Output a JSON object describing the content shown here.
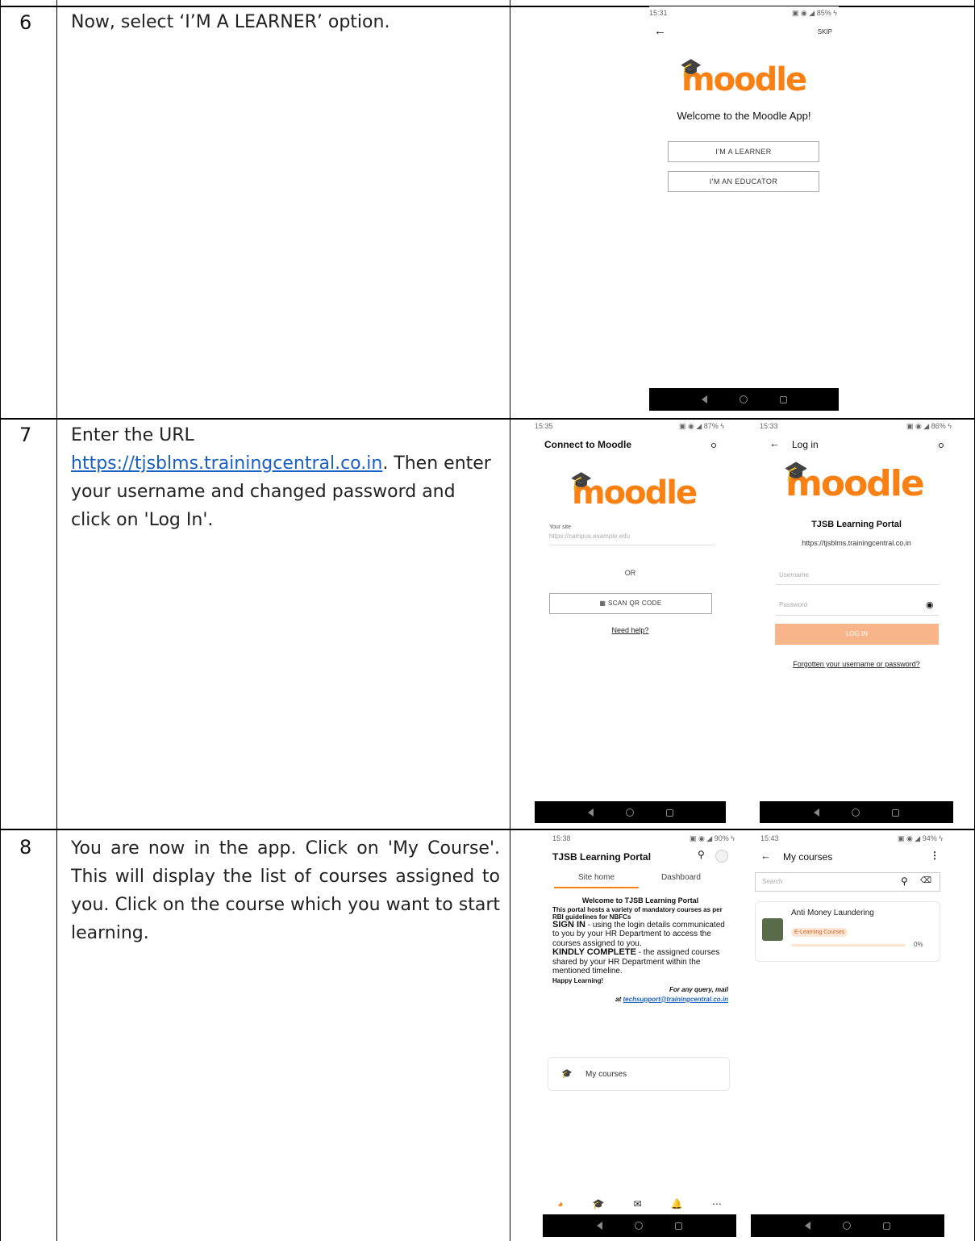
{
  "rows": [
    {
      "num": "6",
      "text": "Now, select ‘I’M A LEARNER’ option."
    },
    {
      "num": "7",
      "text_before": "Enter the URL ",
      "link": "https://tjsblms.trainingcentral.co.in",
      "text_after": ". Then enter your username and changed password and click on 'Log In'."
    },
    {
      "num": "8",
      "text": "You are now in the app. Click on 'My Course'. This will display the list of courses assigned to you. Click on the course which you want to start learning."
    }
  ],
  "screen_welcome": {
    "time": "15:31",
    "battery": "85%",
    "skip": "SKIP",
    "logo": "moodle",
    "title": "Welcome to the Moodle App!",
    "learner_button": "I'M A LEARNER",
    "educator_button": "I'M AN EDUCATOR"
  },
  "screen_connect": {
    "time": "15:35",
    "battery": "87%",
    "title": "Connect to Moodle",
    "logo": "moodle",
    "site_label": "Your site",
    "site_placeholder": "https://campus.example.edu",
    "or": "OR",
    "scan_button": "SCAN QR CODE",
    "help_link": "Need help?"
  },
  "screen_login": {
    "time": "15:33",
    "battery": "86%",
    "title": "Log in",
    "logo": "moodle",
    "portal": "TJSB Learning Portal",
    "url": "https://tjsblms.trainingcentral.co.in",
    "username_placeholder": "Username",
    "password_placeholder": "Password",
    "login_button": "LOG IN",
    "forgot_link": "Forgotten your username or password?"
  },
  "screen_home": {
    "time": "15:38",
    "battery": "90%",
    "title": "TJSB Learning Portal",
    "tabs": [
      "Site home",
      "Dashboard"
    ],
    "welcome_heading": "Welcome to TJSB Learning Portal",
    "intro": "This portal hosts a variety of mandatory courses as per RBI guidelines for NBFCs",
    "sign_in_label": "SIGN IN",
    "sign_in_text": " - using the login details communicated to you by your HR Department to access the courses assigned to you.",
    "complete_label": "KINDLY COMPLETE",
    "complete_text": " - the assigned courses shared by your HR Department within the mentioned timeline.",
    "happy": "Happy Learning!",
    "query": "For any query, mail",
    "at": "at ",
    "email": "techsupport@trainingcentral.co.in",
    "my_courses": "My courses"
  },
  "screen_courses": {
    "time": "15:43",
    "battery": "94%",
    "title": "My courses",
    "search_placeholder": "Search",
    "course_name": "Anti Money Laundering",
    "category": "E-Learning Courses",
    "progress": "0%"
  }
}
